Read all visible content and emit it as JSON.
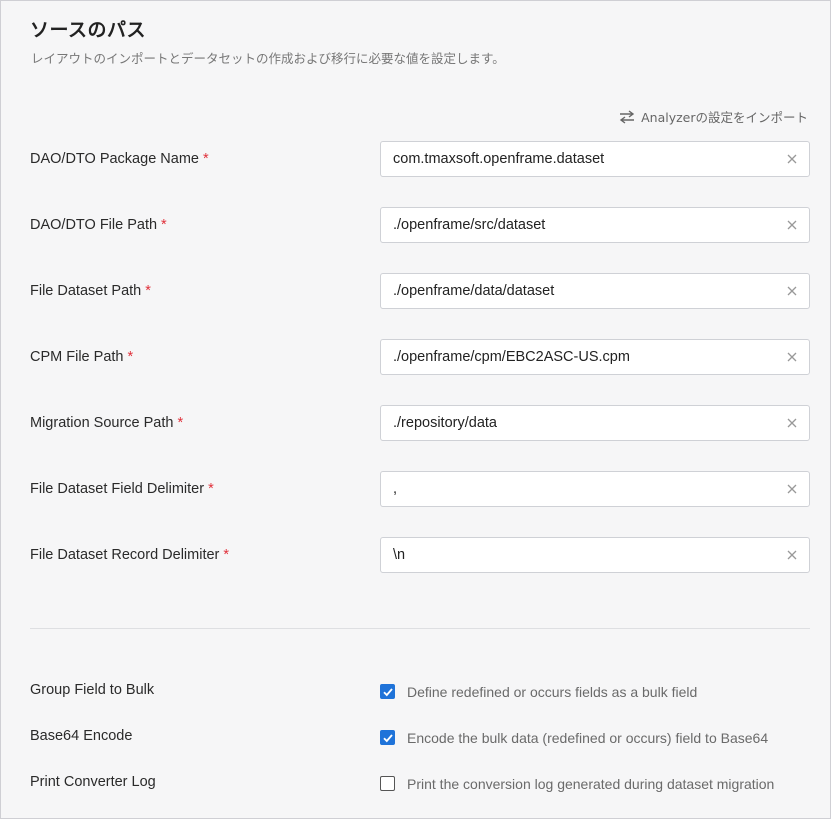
{
  "header": {
    "title": "ソースのパス",
    "subtitle": "レイアウトのインポートとデータセットの作成および移行に必要な値を設定します。"
  },
  "import_link": {
    "label": "Analyzerの設定をインポート",
    "icon": "swap-arrows-icon"
  },
  "required_mark": "*",
  "fields": [
    {
      "label": "DAO/DTO Package Name",
      "value": "com.tmaxsoft.openframe.dataset"
    },
    {
      "label": "DAO/DTO File Path",
      "value": "./openframe/src/dataset"
    },
    {
      "label": "File Dataset Path",
      "value": "./openframe/data/dataset"
    },
    {
      "label": "CPM File Path",
      "value": "./openframe/cpm/EBC2ASC-US.cpm"
    },
    {
      "label": "Migration Source Path",
      "value": "./repository/data"
    },
    {
      "label": "File Dataset Field Delimiter",
      "value": ","
    },
    {
      "label": "File Dataset Record Delimiter",
      "value": "\\n"
    }
  ],
  "options": [
    {
      "label": "Group Field to Bulk",
      "checked": true,
      "text": "Define redefined or occurs fields as a bulk field"
    },
    {
      "label": "Base64 Encode",
      "checked": true,
      "text": "Encode the bulk data (redefined or occurs) field to Base64"
    },
    {
      "label": "Print Converter Log",
      "checked": false,
      "text": "Print the conversion log generated during dataset migration"
    }
  ],
  "colors": {
    "accent": "#1f73d9",
    "required": "#e0303a"
  }
}
